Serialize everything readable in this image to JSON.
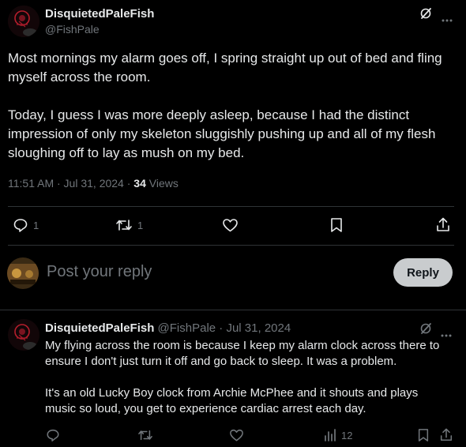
{
  "main_post": {
    "author_name": "DisquietedPaleFish",
    "author_handle": "@FishPale",
    "paragraph_1_line_1": "Most mornings my alarm goes off, I spring straight up out of bed and fling",
    "paragraph_1_line_2": "myself across the room.",
    "paragraph_2_line_1": "Today, I guess I was more deeply asleep, because I had the distinct",
    "paragraph_2_line_2": "impression of only my skeleton sluggishly pushing up and all of my flesh",
    "paragraph_2_line_3": "sloughing off to lay as mush on my bed.",
    "timestamp": "11:51 AM · Jul 31, 2024 ·",
    "views_count": "34",
    "views_label": "Views",
    "reply_count": "1",
    "repost_count": "1"
  },
  "composer": {
    "placeholder": "Post your reply",
    "reply_button": "Reply"
  },
  "reply_post": {
    "author_name": "DisquietedPaleFish",
    "meta": "@FishPale · Jul 31, 2024",
    "paragraph_1_line_1": "My flying across the room is because I keep my alarm clock across there to",
    "paragraph_1_line_2": "ensure I don't just turn it off and go back to sleep. It was a problem.",
    "paragraph_2_line_1": "It's an old Lucky Boy clock from Archie McPhee and it shouts and plays",
    "paragraph_2_line_2": "music so loud, you get to experience cardiac arrest each day.",
    "views_count": "12"
  },
  "colors": {
    "background": "#000000",
    "text": "#e7e9ea",
    "muted": "#71767b",
    "divider": "#2f3336",
    "reply_button": "#c9ccce"
  }
}
